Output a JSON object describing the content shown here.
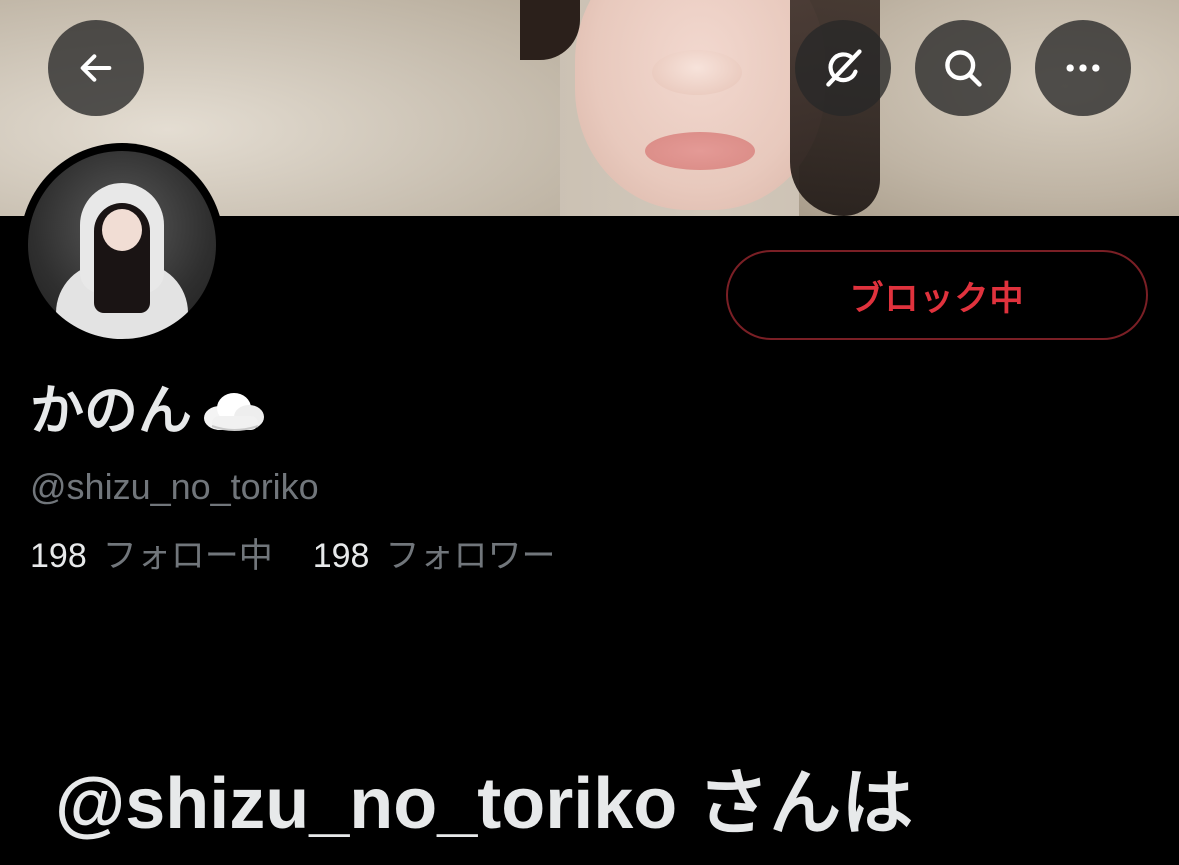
{
  "header": {
    "back_icon": "arrow-left-icon",
    "grok_icon": "grok-icon",
    "search_icon": "search-icon",
    "more_icon": "more-horizontal-icon"
  },
  "profile": {
    "display_name": "かのん",
    "name_emoji": "cloud-emoji",
    "handle": "@shizu_no_toriko",
    "following_count": "198",
    "following_label": "フォロー中",
    "followers_count": "198",
    "followers_label": "フォロワー"
  },
  "actions": {
    "blocked_label": "ブロック中"
  },
  "blocked_notice": {
    "text": "@shizu_no_toriko さんは"
  },
  "colors": {
    "background": "#000000",
    "primary_text": "#e7e9ea",
    "secondary_text": "#71767b",
    "blocked_red": "#e0323d",
    "blocked_border": "#7a1f25"
  }
}
